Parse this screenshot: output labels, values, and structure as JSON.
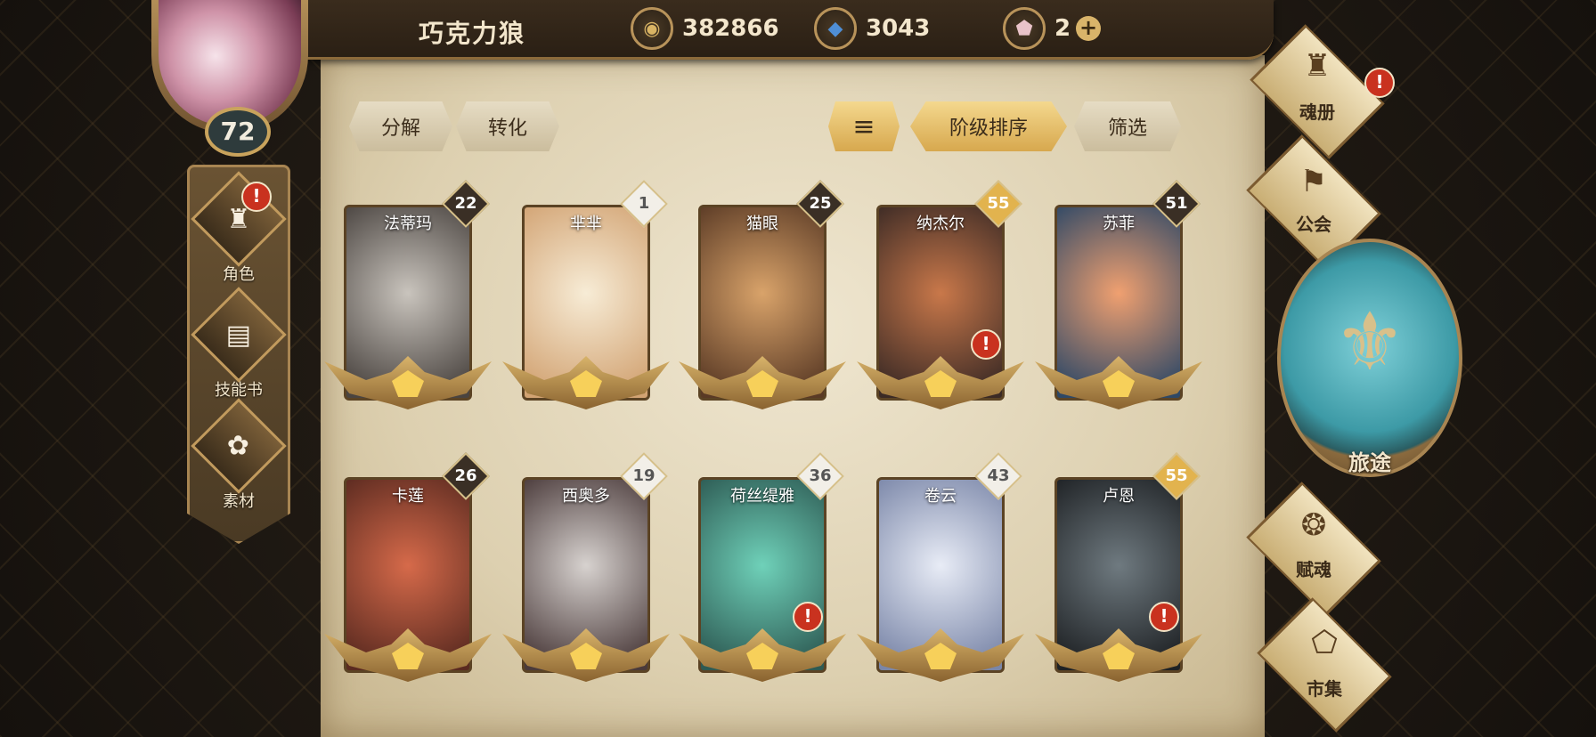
{
  "player": {
    "name": "巧克力狼",
    "level": "72"
  },
  "resources": [
    {
      "icon": "gold-coin-icon",
      "glyph": "◉",
      "color": "#d9b464",
      "value": "382866"
    },
    {
      "icon": "blue-crystal-icon",
      "glyph": "◆",
      "color": "#4f8fd6",
      "value": "3043"
    },
    {
      "icon": "pink-gem-icon",
      "glyph": "⬟",
      "color": "#e9c3c9",
      "value": "2"
    }
  ],
  "plus_label": "+",
  "left_nav": [
    {
      "label": "角色",
      "icon": "helmet-icon",
      "glyph": "♜",
      "alert": "!"
    },
    {
      "label": "技能书",
      "icon": "skill-book-icon",
      "glyph": "▤"
    },
    {
      "label": "素材",
      "icon": "creature-icon",
      "glyph": "✿"
    }
  ],
  "toolbar": {
    "decompose": "分解",
    "convert": "转化",
    "sort_icon": "≡",
    "sort": "阶级排序",
    "filter": "筛选"
  },
  "heroes": [
    {
      "name": "法蒂玛",
      "level": "22",
      "badge": "dark",
      "art": [
        "#c9c4bd",
        "#4a4440"
      ],
      "alert": false
    },
    {
      "name": "芈芈",
      "level": "1",
      "badge": "light",
      "art": [
        "#f7ecd6",
        "#d2a373"
      ],
      "alert": false
    },
    {
      "name": "猫眼",
      "level": "25",
      "badge": "dark",
      "art": [
        "#d9a36a",
        "#5a3a25"
      ],
      "alert": false
    },
    {
      "name": "纳杰尔",
      "level": "55",
      "badge": "gold",
      "art": [
        "#c9784a",
        "#3b2a25"
      ],
      "alert": true
    },
    {
      "name": "苏菲",
      "level": "51",
      "badge": "dark",
      "art": [
        "#f0a070",
        "#2e4866"
      ],
      "alert": false
    },
    {
      "name": "卡莲",
      "level": "26",
      "badge": "dark",
      "art": [
        "#d66a4a",
        "#5a2a20"
      ],
      "alert": false
    },
    {
      "name": "西奥多",
      "level": "19",
      "badge": "light",
      "art": [
        "#d7d2cf",
        "#4a3a3a"
      ],
      "alert": false
    },
    {
      "name": "荷丝缇雅",
      "level": "36",
      "badge": "light",
      "art": [
        "#6fd1b9",
        "#2d5a53"
      ],
      "alert": true
    },
    {
      "name": "卷云",
      "level": "43",
      "badge": "light",
      "art": [
        "#e8ecf6",
        "#7a86a8"
      ],
      "alert": false
    },
    {
      "name": "卢恩",
      "level": "55",
      "badge": "gold",
      "art": [
        "#6f7a80",
        "#1e2124"
      ],
      "alert": true
    }
  ],
  "alert_mark": "!",
  "right_menu": {
    "soul_book": {
      "label": "魂册",
      "glyph": "♜",
      "alert": "!"
    },
    "guild": {
      "label": "公会",
      "glyph": "⚑"
    },
    "journey": {
      "label": "旅途",
      "glyph": "⚜"
    },
    "imbue": {
      "label": "赋魂",
      "glyph": "❂"
    },
    "market": {
      "label": "市集",
      "glyph": "⬠"
    }
  }
}
